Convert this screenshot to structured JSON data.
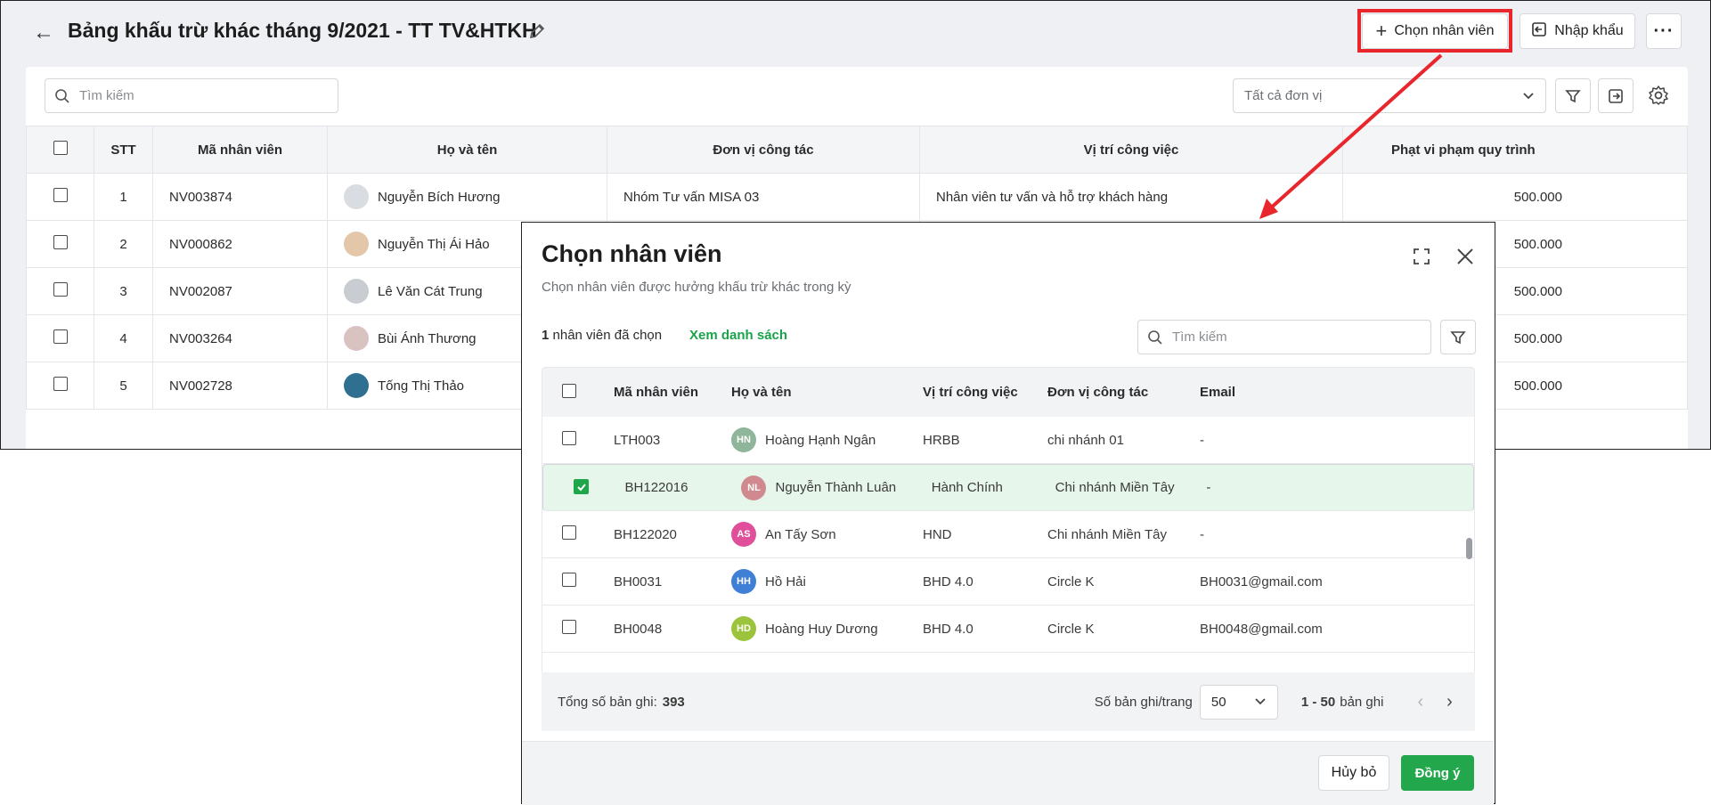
{
  "page": {
    "title": "Bảng khấu trừ khác tháng 9/2021 - TT TV&HTKH",
    "add_label": "Chọn nhân viên",
    "import_label": "Nhập khẩu",
    "search_placeholder": "Tìm kiếm",
    "unit_filter": "Tất cả đơn vị"
  },
  "main_table": {
    "headers": [
      "STT",
      "Mã nhân viên",
      "Họ và tên",
      "Đơn vị công tác",
      "Vị trí công việc",
      "Phạt vi phạm quy trình"
    ],
    "rows": [
      {
        "stt": "1",
        "code": "NV003874",
        "name": "Nguyễn Bích Hương",
        "unit": "Nhóm Tư vấn MISA 03",
        "position": "Nhân viên tư vấn và hỗ trợ khách hàng",
        "fine": "500.000"
      },
      {
        "stt": "2",
        "code": "NV000862",
        "name": "Nguyễn Thị Ái Hảo",
        "unit": "",
        "position": "",
        "fine": "500.000"
      },
      {
        "stt": "3",
        "code": "NV002087",
        "name": "Lê Văn Cát Trung",
        "unit": "",
        "position": "",
        "fine": "500.000"
      },
      {
        "stt": "4",
        "code": "NV003264",
        "name": "Bùi Ánh Thương",
        "unit": "",
        "position": "",
        "fine": "500.000"
      },
      {
        "stt": "5",
        "code": "NV002728",
        "name": "Tống Thị Thảo",
        "unit": "",
        "position": "",
        "fine": "500.000"
      }
    ]
  },
  "dialog": {
    "title": "Chọn nhân viên",
    "subtitle": "Chọn nhân viên được hưởng khấu trừ khác trong kỳ",
    "selected_count": "1",
    "selected_text": "nhân viên đã chọn",
    "view_list": "Xem danh sách",
    "search_placeholder": "Tìm kiếm",
    "headers": [
      "Mã nhân viên",
      "Họ và tên",
      "Vị trí công việc",
      "Đơn vị công tác",
      "Email"
    ],
    "rows": [
      {
        "code": "LTH003",
        "initials": "HN",
        "color": "#8fb59a",
        "name": "Hoàng Hạnh Ngân",
        "position": "HRBB",
        "unit": "chi nhánh 01",
        "email": "-",
        "checked": false
      },
      {
        "code": "BH122016",
        "initials": "NL",
        "color": "#d08a8f",
        "name": "Nguyễn Thành Luân",
        "position": "Hành Chính",
        "unit": "Chi nhánh Miền Tây",
        "email": "-",
        "checked": true
      },
      {
        "code": "BH122020",
        "initials": "AS",
        "color": "#e0509a",
        "name": "An Tấy Sơn",
        "position": "HND",
        "unit": "Chi nhánh Miền Tây",
        "email": "-",
        "checked": false
      },
      {
        "code": "BH0031",
        "initials": "HH",
        "color": "#3f7fd6",
        "name": "Hồ Hải",
        "position": "BHD 4.0",
        "unit": "Circle K",
        "email": "BH0031@gmail.com",
        "checked": false
      },
      {
        "code": "BH0048",
        "initials": "HD",
        "color": "#9bc43c",
        "name": "Hoàng Huy Dương",
        "position": "BHD 4.0",
        "unit": "Circle K",
        "email": "BH0048@gmail.com",
        "checked": false
      }
    ],
    "total_label": "Tổng số bản ghi:",
    "total_value": "393",
    "per_page_label": "Số bản ghi/trang",
    "per_page_value": "50",
    "range_strong": "1 - 50",
    "range_text": "bản ghi",
    "cancel_label": "Hủy bỏ",
    "ok_label": "Đồng ý"
  },
  "colors": {
    "accent": "#22a74c",
    "highlight": "#e8262c"
  }
}
